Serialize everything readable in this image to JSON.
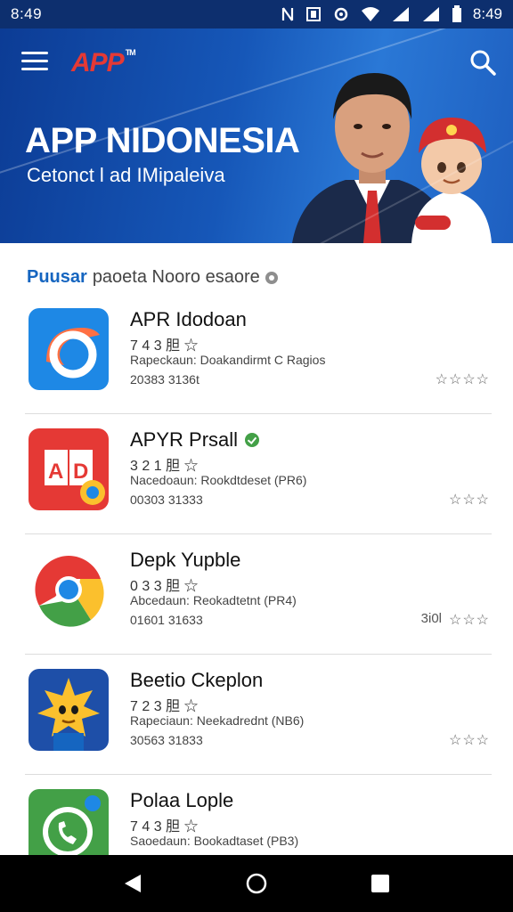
{
  "status_bar": {
    "left_time": "8:49",
    "right_time": "8:49"
  },
  "header": {
    "logo_text": "APP",
    "logo_tm": "TM",
    "title": "APP NIDONESIA",
    "subtitle": "Cetonct l ad IMipaleiva"
  },
  "section": {
    "title_strong": "Puusar",
    "title_rest": "paoeta Nooro esaore"
  },
  "apps": [
    {
      "name": "APR Idodoan",
      "count": "7 4 3 胆 ☆",
      "description": "Rapeckaun: Doakandirmt C Ragios",
      "meta": "20383 3136t",
      "rating": "☆☆☆☆",
      "extra": "",
      "icon": "blue-arc-app-icon",
      "verified": false
    },
    {
      "name": "APYR Prsall",
      "count": "3 2 1 胆 ☆",
      "description": "Nacedoaun: Rookdtdeset (PR6)",
      "meta": "00303 31333",
      "rating": "☆☆☆",
      "extra": "",
      "icon": "red-ad-app-icon",
      "verified": true
    },
    {
      "name": "Depk Yupble",
      "count": "0 3 3 胆 ☆",
      "description": "Abcedaun: Reokadtetnt (PR4)",
      "meta": "01601 31633",
      "rating": "☆☆☆",
      "extra": "3i0l",
      "icon": "chrome-like-app-icon",
      "verified": false
    },
    {
      "name": "Beetio Ckeplon",
      "count": "7 2 3 胆 ☆",
      "description": "Rapeciaun: Neekadrednt (NB6)",
      "meta": "30563 31833",
      "rating": "☆☆☆",
      "extra": "",
      "icon": "yellow-star-app-icon",
      "verified": false
    },
    {
      "name": "Polaa Lople",
      "count": "7 4 3 胆 ☆",
      "description": "Saoedaun: Bookadtaset (PB3)",
      "meta": "",
      "rating": "",
      "extra": "",
      "icon": "phone-chat-app-icon",
      "verified": false
    }
  ],
  "colors": {
    "status_bar": "#0d2f6e",
    "hero_primary": "#1657b8",
    "accent_blue": "#1565c0",
    "logo_red": "#e53935"
  }
}
